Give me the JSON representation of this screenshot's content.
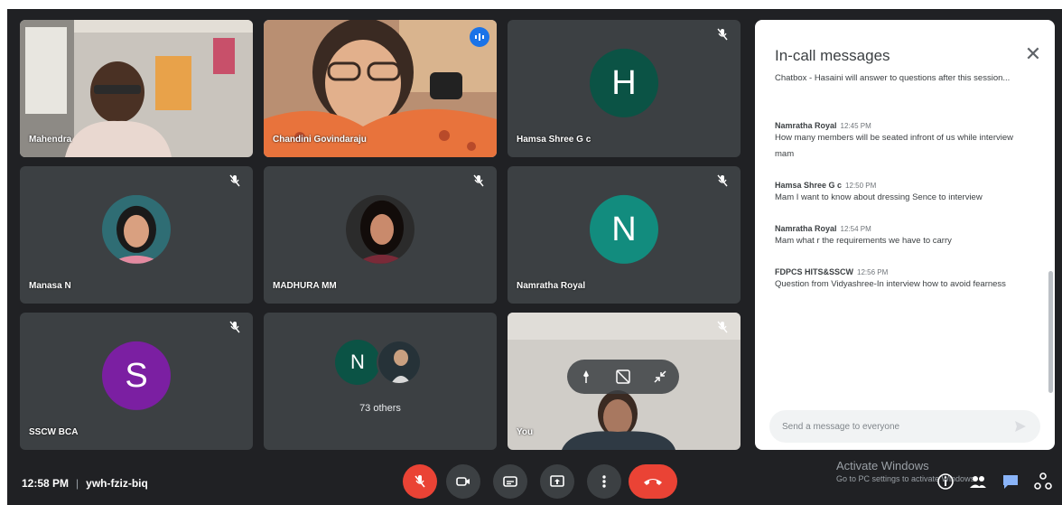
{
  "meeting": {
    "time": "12:58 PM",
    "separator": "|",
    "code": "ywh-fziz-biq"
  },
  "tiles": {
    "t1_name": "Mahendra",
    "t2_name": "Chandini Govindaraju",
    "t3_name": "Hamsa Shree G c",
    "t3_initial": "H",
    "t4_name": "Manasa N",
    "t5_name": "MADHURA MM",
    "t6_name": "Namratha Royal",
    "t6_initial": "N",
    "t7_name": "SSCW BCA",
    "t7_initial": "S",
    "t8_initial": "N",
    "t8_label": "73 others",
    "t9_name": "You"
  },
  "chat": {
    "title": "In-call messages",
    "close": "✕",
    "cut_text": "Chatbox - Hasaini will answer to questions after this session...",
    "messages": [
      {
        "sender": "Namratha Royal",
        "time": "12:45 PM",
        "text": "How many members will be seated infront of us while interview mam"
      },
      {
        "sender": "Hamsa Shree G c",
        "time": "12:50 PM",
        "text": "Mam I want to know about dressing Sence to interview"
      },
      {
        "sender": "Namratha Royal",
        "time": "12:54 PM",
        "text": "Mam what r the requirements we have to carry"
      },
      {
        "sender": "FDPCS HITS&SSCW",
        "time": "12:56 PM",
        "text": "Question from Vidyashree-In interview how to avoid fearness"
      }
    ],
    "input_placeholder": "Send a message to everyone"
  },
  "watermark": {
    "line1": "Activate Windows",
    "line2": "Go to PC settings to activate Windows."
  },
  "colors": {
    "bg": "#202124",
    "tile": "#3c4043",
    "red": "#ea4335",
    "avatar_green": "#0b5345",
    "avatar_teal": "#128c7e",
    "avatar_purple": "#7b1fa2"
  }
}
